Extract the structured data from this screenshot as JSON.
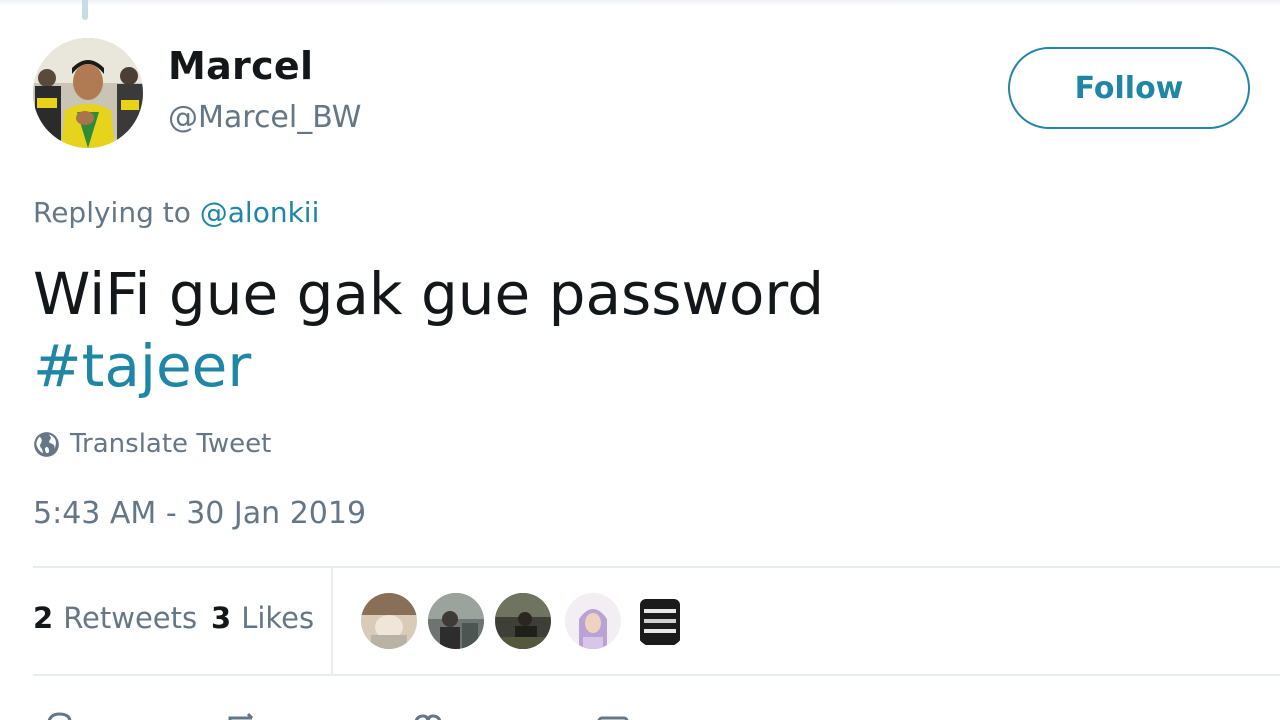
{
  "tweet": {
    "author": {
      "display_name": "Marcel",
      "handle": "@Marcel_BW",
      "avatar_icon": "user-photo-avatar"
    },
    "follow_label": "Follow",
    "replying": {
      "prefix": "Replying to",
      "mention": "@alonkii"
    },
    "text": "WiFi gue gak gue password",
    "hashtag": "#tajeer",
    "translate_label": "Translate Tweet",
    "timestamp": "5:43 AM - 30 Jan 2019",
    "stats": {
      "retweets_count": "2",
      "retweets_label": "Retweets",
      "likes_count": "3",
      "likes_label": "Likes"
    },
    "likers": [
      {
        "icon": "liker-avatar-1"
      },
      {
        "icon": "liker-avatar-2"
      },
      {
        "icon": "liker-avatar-3"
      },
      {
        "icon": "liker-avatar-4"
      },
      {
        "icon": "liker-avatar-5"
      }
    ],
    "actions": [
      "reply-icon",
      "retweet-icon",
      "like-icon",
      "message-icon"
    ]
  },
  "colors": {
    "accent": "#1f86a6",
    "text": "#14171a",
    "secondary": "#657786",
    "divider": "#e6ecf0"
  }
}
